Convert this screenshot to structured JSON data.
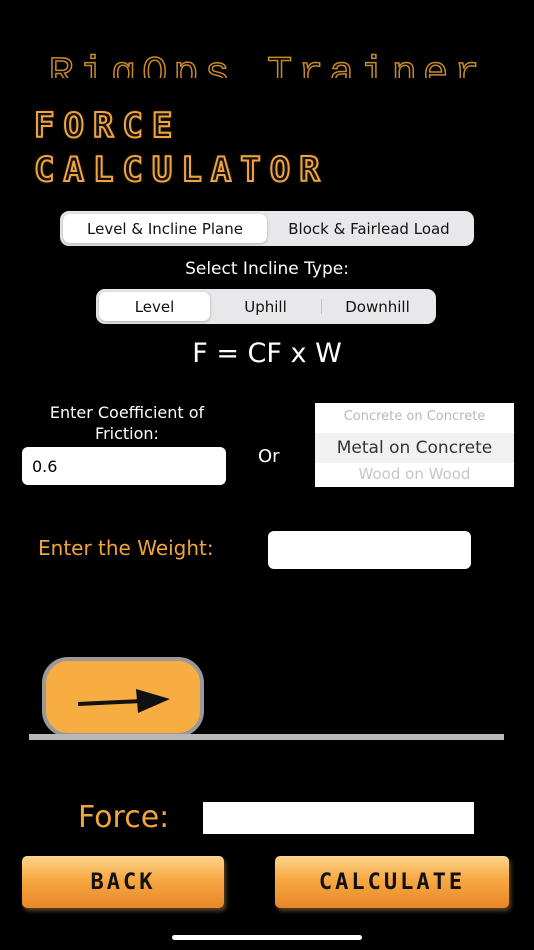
{
  "app_title": "RigOps Trainer",
  "title": {
    "line1": "FORCE",
    "line2": "CALCULATOR"
  },
  "mode_tabs": {
    "items": [
      {
        "label": "Level & Incline Plane",
        "selected": true
      },
      {
        "label": "Block & Fairlead Load",
        "selected": false
      }
    ]
  },
  "incline": {
    "label": "Select Incline Type:",
    "options": [
      {
        "label": "Level",
        "selected": true
      },
      {
        "label": "Uphill",
        "selected": false
      },
      {
        "label": "Downhill",
        "selected": false
      }
    ]
  },
  "formula": "F = CF x W",
  "coefficient": {
    "label": "Enter Coefficient of Friction:",
    "value": "0.6"
  },
  "or_label": "Or",
  "material_picker": {
    "above": "Concrete on Concrete",
    "selected": "Metal on Concrete",
    "below": "Wood on Wood"
  },
  "weight": {
    "label": "Enter the Weight:",
    "value": ""
  },
  "force": {
    "label": "Force:",
    "value": ""
  },
  "buttons": {
    "back": "BACK",
    "calculate": "CALCULATE"
  },
  "colors": {
    "accent": "#f0a43c",
    "background": "#000000"
  },
  "icons": {
    "block_arrow": "right-arrow-icon"
  }
}
